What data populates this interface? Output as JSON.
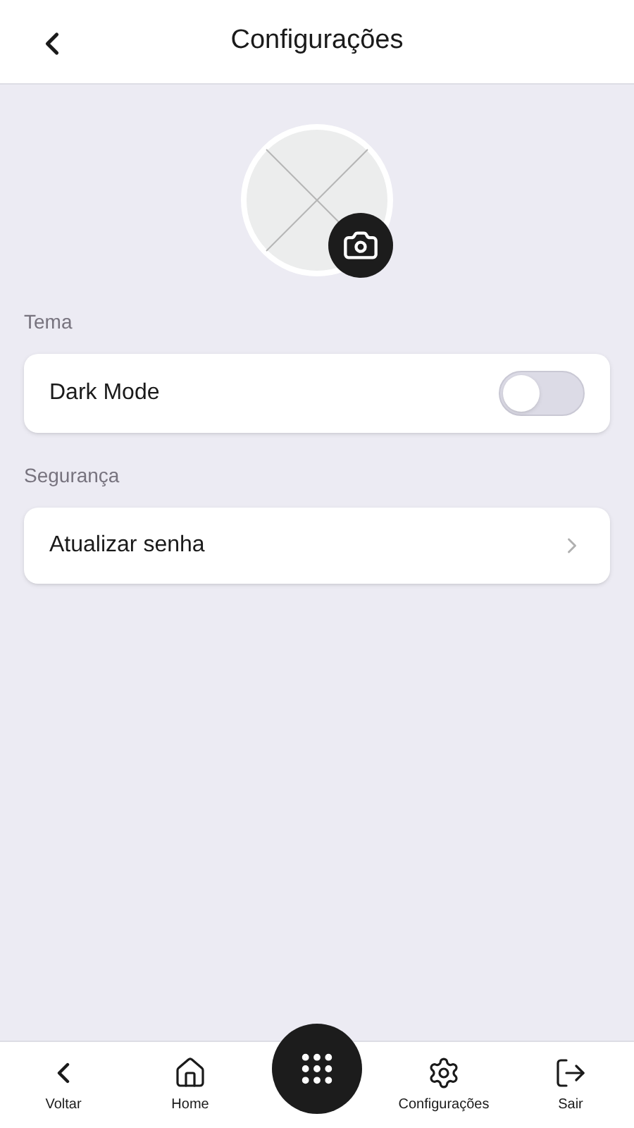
{
  "header": {
    "title": "Configurações"
  },
  "sections": [
    {
      "title": "Tema",
      "items": [
        {
          "kind": "toggle",
          "label": "Dark Mode",
          "on": false
        }
      ]
    },
    {
      "title": "Segurança",
      "items": [
        {
          "kind": "link",
          "label": "Atualizar senha"
        }
      ]
    }
  ],
  "bottom_nav": [
    {
      "kind": "back",
      "label": "Voltar"
    },
    {
      "kind": "home",
      "label": "Home"
    },
    {
      "kind": "menu"
    },
    {
      "kind": "settings",
      "label": "Configurações"
    },
    {
      "kind": "logout",
      "label": "Sair"
    }
  ]
}
